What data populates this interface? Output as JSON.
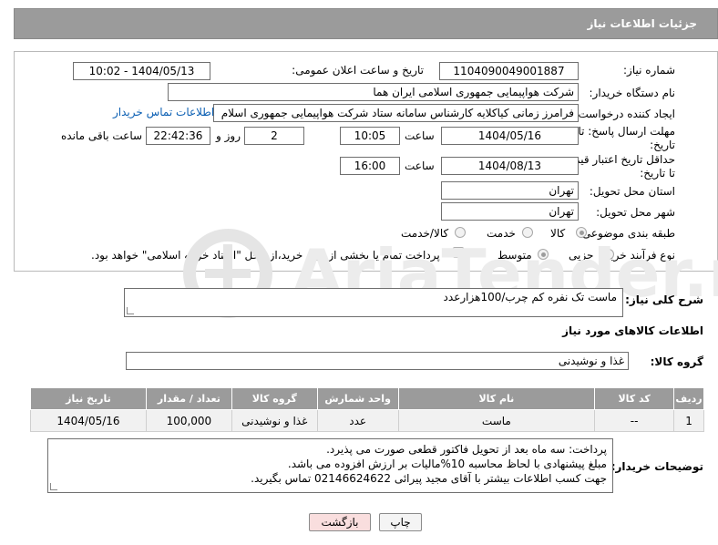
{
  "header": {
    "title": "جزئیات اطلاعات نیاز"
  },
  "fields": {
    "need_number_label": "شماره نیاز:",
    "need_number": "1104090049001887",
    "announce_label": "تاریخ و ساعت اعلان عمومی:",
    "announce_value": "1404/05/13 - 10:02",
    "buyer_org_label": "نام دستگاه خریدار:",
    "buyer_org": "شرکت هواپیمایی جمهوری اسلامی ایران هما",
    "requester_label": "ایجاد کننده درخواست:",
    "requester": "فرامرز زمانی کیاکلایه کارشناس سامانه ستاد شرکت هواپیمایی جمهوری اسلام",
    "buyer_contact_link": "اطلاعات تماس خریدار",
    "reply_deadline_label_1": "مهلت ارسال پاسخ: تا",
    "reply_deadline_label_2": "تاریخ:",
    "reply_date": "1404/05/16",
    "time_label": "ساعت",
    "reply_time": "10:05",
    "days_value": "2",
    "days_label": "روز و",
    "remaining_time": "22:42:36",
    "remaining_label": "ساعت باقی مانده",
    "price_validity_label_1": "حداقل تاریخ اعتبار قیمت:",
    "price_validity_label_2": "تا تاریخ:",
    "validity_date": "1404/08/13",
    "validity_time_label": "ساعت",
    "validity_time": "16:00",
    "province_label": "استان محل تحویل:",
    "province": "تهران",
    "city_label": "شهر محل تحویل:",
    "city": "تهران",
    "category_label": "طبقه بندی موضوعی:",
    "category_options": [
      "کالا",
      "خدمت",
      "کالا/خدمت"
    ],
    "process_label": "نوع فرآیند خرید :",
    "process_options": [
      "جزیی",
      "متوسط"
    ],
    "payment_note": "پرداخت تمام یا بخشی از مبلغ خرید،از محل \"اسناد خزانه اسلامی\" خواهد بود."
  },
  "description": {
    "label": "شرح کلی نیاز:",
    "value": "ماست تک نفره کم چرب/100هزارعدد"
  },
  "goods_section": {
    "title": "اطلاعات کالاهای مورد نیاز",
    "group_label": "گروه کالا:",
    "group_value": "غذا و نوشیدنی"
  },
  "table": {
    "headers": [
      "ردیف",
      "کد کالا",
      "نام کالا",
      "واحد شمارش",
      "گروه کالا",
      "تعداد / مقدار",
      "تاریخ نیاز"
    ],
    "rows": [
      [
        "1",
        "--",
        "ماست",
        "عدد",
        "غذا و نوشیدنی",
        "100,000",
        "1404/05/16"
      ]
    ]
  },
  "notes": {
    "label": "توضیحات خریدار:",
    "line1": "پرداخت: سه ماه بعد از تحویل فاکتور قطعی صورت می پذیرد.",
    "line2": "مبلغ پیشنهادی با لحاظ محاسبه 10%مالیات بر ارزش افزوده می باشد.",
    "line3": "جهت کسب اطلاعات بیشتر با آقای مجید پیرائی 02146624622 تماس بگیرید."
  },
  "buttons": {
    "print": "چاپ",
    "back": "بازگشت"
  },
  "colors": {
    "header_bg": "#9b9b9b",
    "link": "#0b5fb3",
    "back_btn": "#f9dede"
  }
}
